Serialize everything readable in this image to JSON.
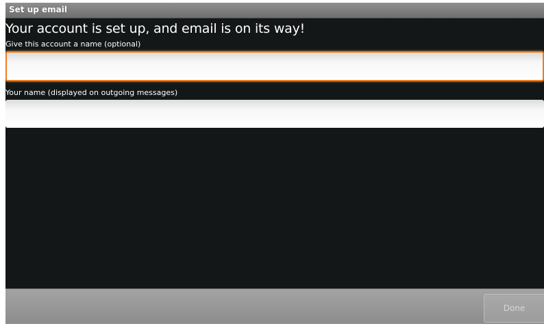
{
  "window": {
    "title": "Set up email"
  },
  "main": {
    "headline": "Your account is set up, and email is on its way!",
    "account_name": {
      "label": "Give this account a name (optional)",
      "value": "",
      "focused": true
    },
    "your_name": {
      "label": "Your name (displayed on outgoing messages)",
      "value": ""
    }
  },
  "footer": {
    "done_label": "Done",
    "done_enabled": false
  },
  "colors": {
    "focus_border": "#f07b1e",
    "background": "#131718",
    "title_bar": "#7f7f7f",
    "bottom_bar": "#989898"
  }
}
